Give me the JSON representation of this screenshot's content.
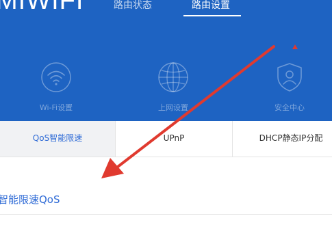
{
  "header": {
    "logo": "MIWIFI",
    "nav": [
      {
        "label": "路由状态",
        "active": false
      },
      {
        "label": "路由设置",
        "active": true
      }
    ],
    "features": [
      {
        "label": "Wi-Fi设置",
        "icon": "wifi-icon"
      },
      {
        "label": "上网设置",
        "icon": "globe-icon"
      },
      {
        "label": "安全中心",
        "icon": "shield-user-icon"
      }
    ]
  },
  "tabs": [
    {
      "label": "QoS智能限速",
      "active": true
    },
    {
      "label": "UPnP",
      "active": false
    },
    {
      "label": "DHCP静态IP分配",
      "active": false
    }
  ],
  "section": {
    "title": "智能限速QoS"
  },
  "annotation": {
    "arrow_color": "#e03a2f"
  },
  "colors": {
    "header_bg": "#1e63c2",
    "accent": "#2f6bd6"
  }
}
